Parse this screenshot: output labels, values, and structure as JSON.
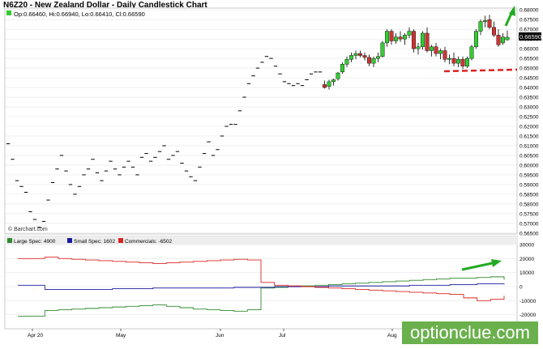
{
  "title": "N6Z20 - New Zealand Dollar - Daily Candlestick Chart",
  "ohlc_label": "Op:0.66460, Hi:0.66940, Lo:0.66410, Cl:0.66590",
  "last_price_tag": "0.66590",
  "source_label": "© Barchart.com",
  "watermark": "optionclue.com",
  "colors": {
    "up": "#33cc33",
    "down": "#cc3333",
    "large_spec": "#2e8b2e",
    "small_spec": "#1a1aa0",
    "commercials": "#dd2222",
    "annotation_arrow": "#22aa22",
    "annotation_line": "#dd2222"
  },
  "chart_data": [
    {
      "type": "candlestick",
      "title": "N6Z20 - New Zealand Dollar - Daily Candlestick Chart",
      "y_ticks": [
        "0.68000",
        "0.67500",
        "0.67000",
        "0.66500",
        "0.66000",
        "0.65500",
        "0.65000",
        "0.64500",
        "0.64000",
        "0.63500",
        "0.63000",
        "0.62500",
        "0.62000",
        "0.61500",
        "0.61000",
        "0.60500",
        "0.60000",
        "0.59500",
        "0.59000",
        "0.58500",
        "0.58000",
        "0.57500",
        "0.57000",
        "0.56500"
      ],
      "ylim": [
        0.5645,
        0.6805
      ],
      "x_ticks": [
        "Apr 20",
        "May",
        "Jun",
        "Jul",
        "Aug"
      ],
      "grid": true,
      "flat_bars": [
        0.611,
        0.603,
        0.592,
        0.589,
        0.586,
        0.576,
        0.572,
        0.568,
        0.571,
        0.582,
        0.591,
        0.598,
        0.605,
        0.597,
        0.59,
        0.585,
        0.589,
        0.595,
        0.598,
        0.603,
        0.596,
        0.592,
        0.597,
        0.602,
        0.598,
        0.595,
        0.599,
        0.602,
        0.599,
        0.595,
        0.604,
        0.606,
        0.602,
        0.604,
        0.607,
        0.61,
        0.603,
        0.605,
        0.607,
        0.601,
        0.597,
        0.594,
        0.592,
        0.599,
        0.606,
        0.612,
        0.605,
        0.608,
        0.615,
        0.62,
        0.621,
        0.621,
        0.628,
        0.635,
        0.642,
        0.646,
        0.65,
        0.653,
        0.656,
        0.655,
        0.651,
        0.647,
        0.643,
        0.642,
        0.641,
        0.642,
        0.641,
        0.644,
        0.647,
        0.648,
        0.648
      ],
      "candles": [
        {
          "o": 0.6415,
          "h": 0.6435,
          "l": 0.6395,
          "c": 0.64
        },
        {
          "o": 0.6405,
          "h": 0.644,
          "l": 0.639,
          "c": 0.643
        },
        {
          "o": 0.643,
          "h": 0.6445,
          "l": 0.641,
          "c": 0.644
        },
        {
          "o": 0.6445,
          "h": 0.648,
          "l": 0.6435,
          "c": 0.6475
        },
        {
          "o": 0.648,
          "h": 0.653,
          "l": 0.647,
          "c": 0.652
        },
        {
          "o": 0.652,
          "h": 0.656,
          "l": 0.6505,
          "c": 0.6545
        },
        {
          "o": 0.6545,
          "h": 0.658,
          "l": 0.653,
          "c": 0.6565
        },
        {
          "o": 0.6565,
          "h": 0.659,
          "l": 0.6545,
          "c": 0.6575
        },
        {
          "o": 0.6575,
          "h": 0.659,
          "l": 0.6555,
          "c": 0.6565
        },
        {
          "o": 0.6565,
          "h": 0.658,
          "l": 0.654,
          "c": 0.6555
        },
        {
          "o": 0.6555,
          "h": 0.657,
          "l": 0.651,
          "c": 0.6525
        },
        {
          "o": 0.6525,
          "h": 0.656,
          "l": 0.6505,
          "c": 0.655
        },
        {
          "o": 0.655,
          "h": 0.658,
          "l": 0.653,
          "c": 0.656
        },
        {
          "o": 0.656,
          "h": 0.664,
          "l": 0.6555,
          "c": 0.663
        },
        {
          "o": 0.663,
          "h": 0.67,
          "l": 0.661,
          "c": 0.669
        },
        {
          "o": 0.669,
          "h": 0.67,
          "l": 0.662,
          "c": 0.664
        },
        {
          "o": 0.664,
          "h": 0.668,
          "l": 0.6625,
          "c": 0.666
        },
        {
          "o": 0.666,
          "h": 0.669,
          "l": 0.6635,
          "c": 0.665
        },
        {
          "o": 0.665,
          "h": 0.668,
          "l": 0.662,
          "c": 0.667
        },
        {
          "o": 0.667,
          "h": 0.671,
          "l": 0.6655,
          "c": 0.669
        },
        {
          "o": 0.669,
          "h": 0.67,
          "l": 0.658,
          "c": 0.66
        },
        {
          "o": 0.66,
          "h": 0.663,
          "l": 0.657,
          "c": 0.661
        },
        {
          "o": 0.661,
          "h": 0.669,
          "l": 0.6595,
          "c": 0.668
        },
        {
          "o": 0.668,
          "h": 0.671,
          "l": 0.658,
          "c": 0.659
        },
        {
          "o": 0.659,
          "h": 0.662,
          "l": 0.656,
          "c": 0.661
        },
        {
          "o": 0.661,
          "h": 0.663,
          "l": 0.656,
          "c": 0.6575
        },
        {
          "o": 0.6575,
          "h": 0.66,
          "l": 0.6545,
          "c": 0.659
        },
        {
          "o": 0.659,
          "h": 0.661,
          "l": 0.653,
          "c": 0.6545
        },
        {
          "o": 0.6545,
          "h": 0.657,
          "l": 0.652,
          "c": 0.655
        },
        {
          "o": 0.655,
          "h": 0.658,
          "l": 0.651,
          "c": 0.6525
        },
        {
          "o": 0.6525,
          "h": 0.656,
          "l": 0.6505,
          "c": 0.6545
        },
        {
          "o": 0.6545,
          "h": 0.656,
          "l": 0.6495,
          "c": 0.651
        },
        {
          "o": 0.651,
          "h": 0.656,
          "l": 0.65,
          "c": 0.655
        },
        {
          "o": 0.655,
          "h": 0.662,
          "l": 0.654,
          "c": 0.661
        },
        {
          "o": 0.661,
          "h": 0.67,
          "l": 0.66,
          "c": 0.669
        },
        {
          "o": 0.669,
          "h": 0.675,
          "l": 0.667,
          "c": 0.674
        },
        {
          "o": 0.674,
          "h": 0.677,
          "l": 0.671,
          "c": 0.6745
        },
        {
          "o": 0.675,
          "h": 0.6775,
          "l": 0.67,
          "c": 0.671
        },
        {
          "o": 0.671,
          "h": 0.674,
          "l": 0.666,
          "c": 0.667
        },
        {
          "o": 0.667,
          "h": 0.67,
          "l": 0.661,
          "c": 0.662
        },
        {
          "o": 0.663,
          "h": 0.668,
          "l": 0.662,
          "c": 0.666
        },
        {
          "o": 0.6646,
          "h": 0.6694,
          "l": 0.6641,
          "c": 0.6659
        }
      ]
    },
    {
      "type": "line",
      "y_ticks": [
        "30000",
        "20000",
        "10000",
        "0",
        "-10000",
        "-20000"
      ],
      "ylim": [
        -30000,
        30000
      ],
      "series": [
        {
          "name": "Large Spec: 4900",
          "values": [
            -21000,
            -21000,
            -17000,
            -16500,
            -16000,
            -15500,
            -15000,
            -14500,
            -14000,
            -13500,
            -13000,
            -14000,
            -15000,
            -16000,
            -16500,
            -17000,
            -17500,
            -16500,
            -1000,
            -500,
            0,
            500,
            1000,
            1500,
            2000,
            2500,
            3000,
            3500,
            4000,
            4500,
            5000,
            5500,
            6000,
            6000,
            6500,
            7000,
            5000
          ]
        },
        {
          "name": "Small Spec: 1602",
          "values": [
            1000,
            1000,
            -2000,
            -2000,
            -2000,
            -2000,
            -2000,
            -1500,
            -1500,
            -1500,
            -1000,
            -1000,
            -1000,
            -1000,
            -1000,
            -1000,
            -500,
            -500,
            -500,
            0,
            0,
            0,
            0,
            500,
            500,
            500,
            500,
            500,
            500,
            1000,
            1000,
            1000,
            1500,
            1500,
            2000,
            2000,
            1600
          ]
        },
        {
          "name": "Commercials: -6502",
          "values": [
            20000,
            20000,
            21000,
            20000,
            19500,
            19000,
            18500,
            18000,
            17500,
            17000,
            16500,
            17000,
            17500,
            18000,
            18500,
            19000,
            19500,
            19000,
            3000,
            1000,
            500,
            0,
            -500,
            -1000,
            -1500,
            -2000,
            -2500,
            -3000,
            -3500,
            -4000,
            -4500,
            -5000,
            -5500,
            -8000,
            -10000,
            -9000,
            -6500
          ]
        }
      ]
    }
  ]
}
